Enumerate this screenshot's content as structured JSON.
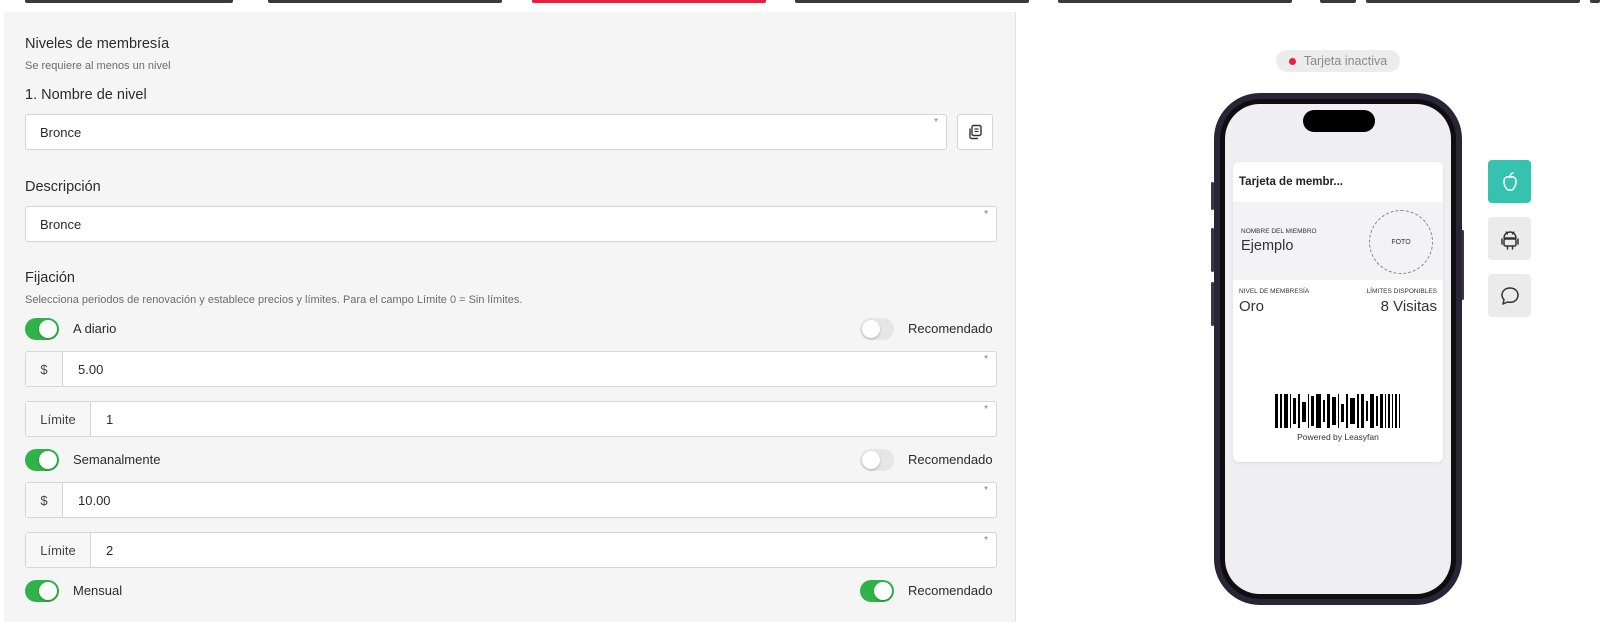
{
  "level_section": {
    "title": "Niveles de membresía",
    "subtitle": "Se requiere al menos un nivel",
    "level_name_label": "1. Nombre de nivel",
    "level_name_value": "Bronce",
    "required_mark": "*",
    "description_label": "Descripción",
    "description_value": "Bronce"
  },
  "pricing": {
    "title": "Fijación",
    "subtitle": "Selecciona periodos de renovación y establece precios y límites. Para el campo Límite 0 = Sin límites.",
    "currency_prefix": "$",
    "limit_prefix": "Límite",
    "recommended_label": "Recomendado",
    "periods": [
      {
        "label": "A diario",
        "enabled": true,
        "recommended": false,
        "price": "5.00",
        "limit": "1"
      },
      {
        "label": "Semanalmente",
        "enabled": true,
        "recommended": false,
        "price": "10.00",
        "limit": "2"
      },
      {
        "label": "Mensual",
        "enabled": true,
        "recommended": true
      }
    ]
  },
  "preview": {
    "status": "Tarjeta inactiva",
    "card_title": "Tarjeta de membr...",
    "member_name_label": "NOMBRE DEL MIEMBRO",
    "member_name_value": "Ejemplo",
    "photo_label": "FOTO",
    "level_label": "NIVEL DE MEMBRESÍA",
    "level_value": "Oro",
    "limits_label": "LÍMITES DISPONIBLES",
    "limits_value": "8 Visitas",
    "powered_by": "Powered by Leasyfan"
  },
  "side_icons": [
    {
      "name": "apple-icon",
      "active": true
    },
    {
      "name": "android-icon",
      "active": false
    },
    {
      "name": "chat-bubble-icon",
      "active": false
    }
  ],
  "colors": {
    "accent_red": "#e8203c",
    "toggle_on": "#2fb24a",
    "teal_active": "#35c2ae"
  }
}
